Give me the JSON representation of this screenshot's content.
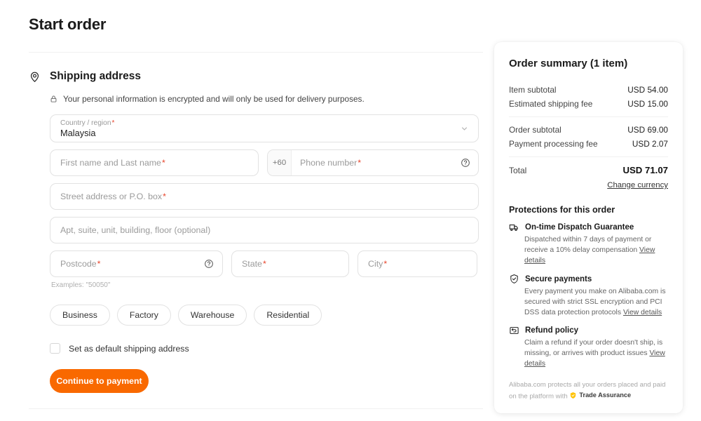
{
  "page": {
    "title": "Start order"
  },
  "shipping": {
    "section_title": "Shipping address",
    "location_icon": "location-pin-icon",
    "privacy_icon": "lock-icon",
    "privacy_note": "Your personal information is encrypted and will only be used for delivery purposes.",
    "country": {
      "label": "Country / region",
      "required_marker": "*",
      "value": "Malaysia",
      "chevron_icon": "chevron-down-icon"
    },
    "name": {
      "placeholder": "First name and Last name",
      "required_marker": "*"
    },
    "phone": {
      "prefix": "+60",
      "placeholder": "Phone number",
      "required_marker": "*",
      "help_icon": "question-circle-icon"
    },
    "street": {
      "placeholder": "Street address or P.O. box",
      "required_marker": "*"
    },
    "apt": {
      "placeholder": "Apt, suite, unit, building, floor (optional)"
    },
    "postcode": {
      "placeholder": "Postcode",
      "required_marker": "*",
      "help_icon": "question-circle-icon",
      "hint": "Examples: \"50050\""
    },
    "state": {
      "placeholder": "State",
      "required_marker": "*"
    },
    "city": {
      "placeholder": "City",
      "required_marker": "*"
    },
    "address_types": [
      {
        "label": "Business"
      },
      {
        "label": "Factory"
      },
      {
        "label": "Warehouse"
      },
      {
        "label": "Residential"
      }
    ],
    "default_checkbox": {
      "label": "Set as default shipping address",
      "checked": false
    },
    "cta_label": "Continue to payment",
    "cta_color": "#f96900"
  },
  "summary": {
    "title": "Order summary (1 item)",
    "rows_group1": [
      {
        "label": "Item subtotal",
        "amount": "USD 54.00"
      },
      {
        "label": "Estimated shipping fee",
        "amount": "USD 15.00"
      }
    ],
    "rows_group2": [
      {
        "label": "Order subtotal",
        "amount": "USD 69.00"
      },
      {
        "label": "Payment processing fee",
        "amount": "USD 2.07"
      }
    ],
    "total": {
      "label": "Total",
      "amount": "USD 71.07"
    },
    "change_currency": "Change currency",
    "protections_title": "Protections for this order",
    "protections": [
      {
        "icon": "dispatch-truck-icon",
        "title": "On-time Dispatch Guarantee",
        "body": "Dispatched within 7 days of payment or receive a 10% delay compensation ",
        "link": "View details"
      },
      {
        "icon": "shield-check-icon",
        "title": "Secure payments",
        "body": "Every payment you make on Alibaba.com is secured with strict SSL encryption and PCI DSS data protection protocols ",
        "link": "View details"
      },
      {
        "icon": "refund-box-icon",
        "title": "Refund policy",
        "body": "Claim a refund if your order doesn't ship, is missing, or arrives with product issues ",
        "link": "View details"
      }
    ],
    "footnote_prefix": "Alibaba.com protects all your orders placed and paid on the platform with ",
    "trade_assurance": {
      "icon": "trade-assurance-shield-icon",
      "label": "Trade Assurance",
      "color": "#ffc40c"
    }
  }
}
